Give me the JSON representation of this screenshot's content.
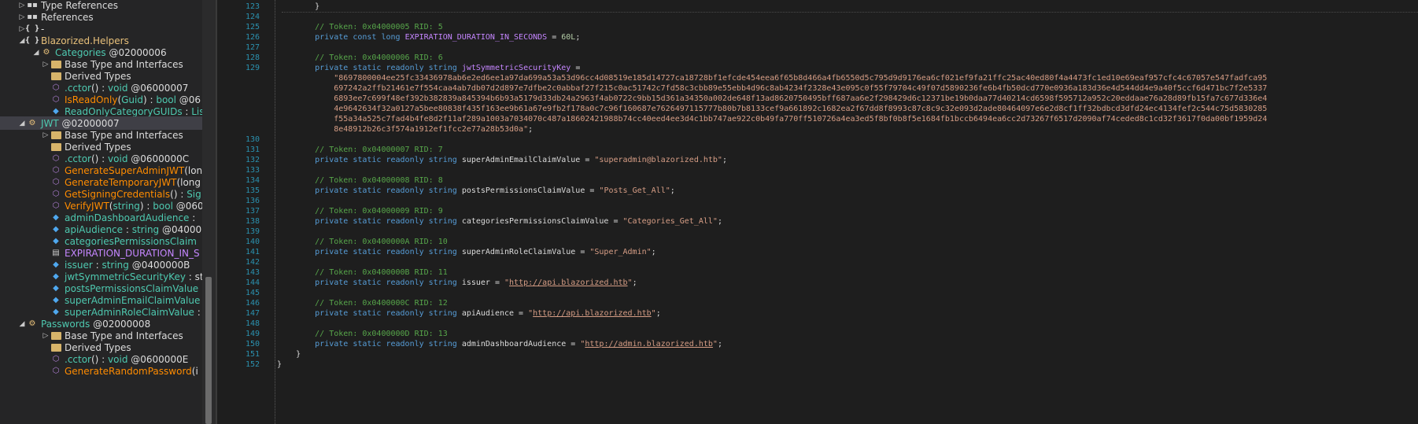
{
  "tree": {
    "items": [
      {
        "indent": 34,
        "arrow": "▷",
        "icon": "references-icon",
        "glyph": "▪▪",
        "parts": [
          {
            "c": "t-plain",
            "t": "Type References"
          }
        ]
      },
      {
        "indent": 34,
        "arrow": "▷",
        "icon": "references-icon",
        "glyph": "▪▪",
        "parts": [
          {
            "c": "t-plain",
            "t": "References"
          }
        ]
      },
      {
        "indent": 34,
        "arrow": "▷",
        "icon": "namespace-icon",
        "glyph": "{ }",
        "parts": [
          {
            "c": "t-plain",
            "t": "-"
          }
        ]
      },
      {
        "indent": 34,
        "arrow": "◢",
        "icon": "namespace-icon",
        "glyph": "{ }",
        "parts": [
          {
            "c": "t-ns",
            "t": "Blazorized.Helpers"
          }
        ]
      },
      {
        "indent": 52,
        "arrow": "◢",
        "icon": "class-icon",
        "glyph": "⚙",
        "parts": [
          {
            "c": "t-class",
            "t": "Categories"
          },
          {
            "c": "t-tok",
            "t": " @02000006"
          }
        ]
      },
      {
        "indent": 64,
        "arrow": "▷",
        "icon": "folder-icon",
        "glyph": "",
        "parts": [
          {
            "c": "t-plain",
            "t": "Base Type and Interfaces"
          }
        ]
      },
      {
        "indent": 64,
        "arrow": "",
        "icon": "folder-icon",
        "glyph": "",
        "parts": [
          {
            "c": "t-plain",
            "t": "Derived Types"
          }
        ]
      },
      {
        "indent": 64,
        "arrow": "",
        "icon": "method-icon",
        "glyph": "⬡",
        "parts": [
          {
            "c": "t-class",
            "t": ".cctor"
          },
          {
            "c": "t-plain",
            "t": "() : "
          },
          {
            "c": "t-type",
            "t": "void"
          },
          {
            "c": "t-tok",
            "t": " @06000007"
          }
        ]
      },
      {
        "indent": 64,
        "arrow": "",
        "icon": "method-icon",
        "glyph": "⬡",
        "parts": [
          {
            "c": "t-method",
            "t": "IsReadOnly"
          },
          {
            "c": "t-plain",
            "t": "("
          },
          {
            "c": "t-type",
            "t": "Guid"
          },
          {
            "c": "t-plain",
            "t": ") : "
          },
          {
            "c": "t-type",
            "t": "bool"
          },
          {
            "c": "t-tok",
            "t": " @06"
          }
        ]
      },
      {
        "indent": 64,
        "arrow": "",
        "icon": "field-icon",
        "glyph": "◆",
        "parts": [
          {
            "c": "t-class",
            "t": "ReadOnlyCategoryGUIDs"
          },
          {
            "c": "t-plain",
            "t": " : "
          },
          {
            "c": "t-type",
            "t": "Lis"
          }
        ]
      },
      {
        "indent": 34,
        "arrow": "◢",
        "icon": "class-icon",
        "glyph": "⚙",
        "sel": true,
        "parts": [
          {
            "c": "t-class",
            "t": "JWT"
          },
          {
            "c": "t-tok",
            "t": " @02000007"
          }
        ]
      },
      {
        "indent": 64,
        "arrow": "▷",
        "icon": "folder-icon",
        "glyph": "",
        "parts": [
          {
            "c": "t-plain",
            "t": "Base Type and Interfaces"
          }
        ]
      },
      {
        "indent": 64,
        "arrow": "",
        "icon": "folder-icon",
        "glyph": "",
        "parts": [
          {
            "c": "t-plain",
            "t": "Derived Types"
          }
        ]
      },
      {
        "indent": 64,
        "arrow": "",
        "icon": "method-icon",
        "glyph": "⬡",
        "parts": [
          {
            "c": "t-class",
            "t": ".cctor"
          },
          {
            "c": "t-plain",
            "t": "() : "
          },
          {
            "c": "t-type",
            "t": "void"
          },
          {
            "c": "t-tok",
            "t": " @0600000C"
          }
        ]
      },
      {
        "indent": 64,
        "arrow": "",
        "icon": "method-icon",
        "glyph": "⬡",
        "parts": [
          {
            "c": "t-method",
            "t": "GenerateSuperAdminJWT"
          },
          {
            "c": "t-plain",
            "t": "(lon"
          }
        ]
      },
      {
        "indent": 64,
        "arrow": "",
        "icon": "method-icon",
        "glyph": "⬡",
        "parts": [
          {
            "c": "t-method",
            "t": "GenerateTemporaryJWT"
          },
          {
            "c": "t-plain",
            "t": "(long"
          }
        ]
      },
      {
        "indent": 64,
        "arrow": "",
        "icon": "method-icon",
        "glyph": "⬡",
        "parts": [
          {
            "c": "t-method",
            "t": "GetSigningCredentials"
          },
          {
            "c": "t-plain",
            "t": "() : "
          },
          {
            "c": "t-type",
            "t": "Sig"
          }
        ]
      },
      {
        "indent": 64,
        "arrow": "",
        "icon": "method-icon",
        "glyph": "⬡",
        "parts": [
          {
            "c": "t-method",
            "t": "VerifyJWT"
          },
          {
            "c": "t-plain",
            "t": "("
          },
          {
            "c": "t-type",
            "t": "string"
          },
          {
            "c": "t-plain",
            "t": ") : "
          },
          {
            "c": "t-type",
            "t": "bool"
          },
          {
            "c": "t-tok",
            "t": " @060"
          }
        ]
      },
      {
        "indent": 64,
        "arrow": "",
        "icon": "field-icon",
        "glyph": "◆",
        "parts": [
          {
            "c": "t-class",
            "t": "adminDashboardAudience"
          },
          {
            "c": "t-plain",
            "t": " :"
          }
        ]
      },
      {
        "indent": 64,
        "arrow": "",
        "icon": "field-icon",
        "glyph": "◆",
        "parts": [
          {
            "c": "t-class",
            "t": "apiAudience"
          },
          {
            "c": "t-plain",
            "t": " : "
          },
          {
            "c": "t-type",
            "t": "string"
          },
          {
            "c": "t-tok",
            "t": " @04000"
          }
        ]
      },
      {
        "indent": 64,
        "arrow": "",
        "icon": "field-icon",
        "glyph": "◆",
        "parts": [
          {
            "c": "t-class",
            "t": "categoriesPermissionsClaim"
          }
        ]
      },
      {
        "indent": 64,
        "arrow": "",
        "icon": "const-icon",
        "glyph": "▤",
        "parts": [
          {
            "c": "t-const",
            "t": "EXPIRATION_DURATION_IN_S"
          }
        ]
      },
      {
        "indent": 64,
        "arrow": "",
        "icon": "field-icon",
        "glyph": "◆",
        "parts": [
          {
            "c": "t-class",
            "t": "issuer"
          },
          {
            "c": "t-plain",
            "t": " : "
          },
          {
            "c": "t-type",
            "t": "string"
          },
          {
            "c": "t-tok",
            "t": " @0400000B"
          }
        ]
      },
      {
        "indent": 64,
        "arrow": "",
        "icon": "field-icon",
        "glyph": "◆",
        "parts": [
          {
            "c": "t-class",
            "t": "jwtSymmetricSecurityKey"
          },
          {
            "c": "t-plain",
            "t": " : st"
          }
        ]
      },
      {
        "indent": 64,
        "arrow": "",
        "icon": "field-icon",
        "glyph": "◆",
        "parts": [
          {
            "c": "t-class",
            "t": "postsPermissionsClaimValue"
          }
        ]
      },
      {
        "indent": 64,
        "arrow": "",
        "icon": "field-icon",
        "glyph": "◆",
        "parts": [
          {
            "c": "t-class",
            "t": "superAdminEmailClaimValue"
          }
        ]
      },
      {
        "indent": 64,
        "arrow": "",
        "icon": "field-icon",
        "glyph": "◆",
        "parts": [
          {
            "c": "t-class",
            "t": "superAdminRoleClaimValue"
          },
          {
            "c": "t-plain",
            "t": " :"
          }
        ]
      },
      {
        "indent": 34,
        "arrow": "◢",
        "icon": "class-icon",
        "glyph": "⚙",
        "parts": [
          {
            "c": "t-class",
            "t": "Passwords"
          },
          {
            "c": "t-tok",
            "t": " @02000008"
          }
        ]
      },
      {
        "indent": 64,
        "arrow": "▷",
        "icon": "folder-icon",
        "glyph": "",
        "parts": [
          {
            "c": "t-plain",
            "t": "Base Type and Interfaces"
          }
        ]
      },
      {
        "indent": 64,
        "arrow": "",
        "icon": "folder-icon",
        "glyph": "",
        "parts": [
          {
            "c": "t-plain",
            "t": "Derived Types"
          }
        ]
      },
      {
        "indent": 64,
        "arrow": "",
        "icon": "method-icon",
        "glyph": "⬡",
        "parts": [
          {
            "c": "t-class",
            "t": ".cctor"
          },
          {
            "c": "t-plain",
            "t": "() : "
          },
          {
            "c": "t-type",
            "t": "void"
          },
          {
            "c": "t-tok",
            "t": " @0600000E"
          }
        ]
      },
      {
        "indent": 64,
        "arrow": "",
        "icon": "method-icon",
        "glyph": "⬡",
        "parts": [
          {
            "c": "t-method",
            "t": "GenerateRandomPassword"
          },
          {
            "c": "t-plain",
            "t": "(i"
          }
        ]
      }
    ]
  },
  "editor": {
    "lines": [
      {
        "n": "123",
        "parts": [
          {
            "c": "",
            "t": "        }"
          }
        ]
      },
      {
        "n": "124",
        "parts": []
      },
      {
        "n": "125",
        "parts": [
          {
            "c": "c-comment",
            "t": "        // Token: 0x04000005 RID: 5"
          }
        ]
      },
      {
        "n": "126",
        "parts": [
          {
            "c": "c-kw",
            "t": "        private const long "
          },
          {
            "c": "c-field",
            "t": "EXPIRATION_DURATION_IN_SECONDS"
          },
          {
            "c": "",
            "t": " = "
          },
          {
            "c": "c-num",
            "t": "60L"
          },
          {
            "c": "",
            "t": ";"
          }
        ]
      },
      {
        "n": "127",
        "parts": []
      },
      {
        "n": "128",
        "parts": [
          {
            "c": "c-comment",
            "t": "        // Token: 0x04000006 RID: 6"
          }
        ]
      },
      {
        "n": "129",
        "parts": [
          {
            "c": "c-kw",
            "t": "        private static readonly string "
          },
          {
            "c": "c-field",
            "t": "jwtSymmetricSecurityKey"
          },
          {
            "c": "",
            "t": " ="
          }
        ]
      },
      {
        "n": "",
        "parts": [
          {
            "c": "c-str",
            "t": "            \"8697800004ee25fc33436978ab6e2ed6ee1a97da699a53a53d96cc4d08519e185d14727ca18728bf1efcde454eea6f65b8d466a4fb6550d5c795d9d9176ea6cf021ef9fa21ffc25ac40ed80f4a4473fc1ed10e69eaf957cfc4c67057e547fadfca95"
          }
        ]
      },
      {
        "n": "",
        "parts": [
          {
            "c": "c-str",
            "t": "            697242a2ffb21461e7f554caa4ab7db07d2d897e7dfbe2c0abbaf27f215c0ac51742c7fd58c3cbb89e55ebb4d96c8ab4234f2328e43e095c0f55f79704c49f07d5890236fe6b4fb50dcd770e0936a183d36e4d544dd4e9a40f5ccf6d471bc7f2e5337"
          }
        ]
      },
      {
        "n": "",
        "parts": [
          {
            "c": "c-str",
            "t": "            6893ee7c699f48ef392b382839a845394b6b93a5179d33db24a2963f4ab0722c9bb15d361a34350a002de648f13ad8620750495bff687aa6e2f298429d6c12371be19b0daa77d40214cd6598f595712a952c20eddaae76a28d89fb15fa7c677d336e4"
          }
        ]
      },
      {
        "n": "",
        "parts": [
          {
            "c": "c-str",
            "t": "            4e9642634f32a0127a5bee80838f435f163ee9b61a67e9fb2f178a0c7c96f160687e7626497115777b80b7b8133cef9a661892c1682ea2f67dd8f8993c87c8c9c32e093d2ade80464097e6e2d8cf1ff32bdbcd3dfd24ec4134fef2c544c75d5830285"
          }
        ]
      },
      {
        "n": "",
        "parts": [
          {
            "c": "c-str",
            "t": "            f55a34a525c7fad4b4fe8d2f11af289a1003a7034070c487a18602421988b74cc40eed4ee3d4c1bb747ae922c0b49fa770ff510726a4ea3ed5f8bf0b8f5e1684fb1bccb6494ea6cc2d73267f6517d2090af74ceded8c1cd32f3617f0da00bf1959d24"
          }
        ]
      },
      {
        "n": "",
        "parts": [
          {
            "c": "c-str",
            "t": "            8e48912b26c3f574a1912ef1fcc2e77a28b53d0a\""
          },
          {
            "c": "",
            "t": ";"
          }
        ]
      },
      {
        "n": "130",
        "parts": []
      },
      {
        "n": "131",
        "parts": [
          {
            "c": "c-comment",
            "t": "        // Token: 0x04000007 RID: 7"
          }
        ]
      },
      {
        "n": "132",
        "parts": [
          {
            "c": "c-kw",
            "t": "        private static readonly string "
          },
          {
            "c": "",
            "t": "superAdminEmailClaimValue = "
          },
          {
            "c": "c-str",
            "t": "\"superadmin@blazorized.htb\""
          },
          {
            "c": "",
            "t": ";"
          }
        ]
      },
      {
        "n": "133",
        "parts": []
      },
      {
        "n": "134",
        "parts": [
          {
            "c": "c-comment",
            "t": "        // Token: 0x04000008 RID: 8"
          }
        ]
      },
      {
        "n": "135",
        "parts": [
          {
            "c": "c-kw",
            "t": "        private static readonly string "
          },
          {
            "c": "",
            "t": "postsPermissionsClaimValue = "
          },
          {
            "c": "c-str",
            "t": "\"Posts_Get_All\""
          },
          {
            "c": "",
            "t": ";"
          }
        ]
      },
      {
        "n": "136",
        "parts": []
      },
      {
        "n": "137",
        "parts": [
          {
            "c": "c-comment",
            "t": "        // Token: 0x04000009 RID: 9"
          }
        ]
      },
      {
        "n": "138",
        "parts": [
          {
            "c": "c-kw",
            "t": "        private static readonly string "
          },
          {
            "c": "",
            "t": "categoriesPermissionsClaimValue = "
          },
          {
            "c": "c-str",
            "t": "\"Categories_Get_All\""
          },
          {
            "c": "",
            "t": ";"
          }
        ]
      },
      {
        "n": "139",
        "parts": []
      },
      {
        "n": "140",
        "parts": [
          {
            "c": "c-comment",
            "t": "        // Token: 0x0400000A RID: 10"
          }
        ]
      },
      {
        "n": "141",
        "parts": [
          {
            "c": "c-kw",
            "t": "        private static readonly string "
          },
          {
            "c": "",
            "t": "superAdminRoleClaimValue = "
          },
          {
            "c": "c-str",
            "t": "\"Super_Admin\""
          },
          {
            "c": "",
            "t": ";"
          }
        ]
      },
      {
        "n": "142",
        "parts": []
      },
      {
        "n": "143",
        "parts": [
          {
            "c": "c-comment",
            "t": "        // Token: 0x0400000B RID: 11"
          }
        ]
      },
      {
        "n": "144",
        "parts": [
          {
            "c": "c-kw",
            "t": "        private static readonly string "
          },
          {
            "c": "",
            "t": "issuer = "
          },
          {
            "c": "c-str",
            "t": "\""
          },
          {
            "c": "c-link",
            "t": "http://api.blazorized.htb"
          },
          {
            "c": "c-str",
            "t": "\""
          },
          {
            "c": "",
            "t": ";"
          }
        ]
      },
      {
        "n": "145",
        "parts": []
      },
      {
        "n": "146",
        "parts": [
          {
            "c": "c-comment",
            "t": "        // Token: 0x0400000C RID: 12"
          }
        ]
      },
      {
        "n": "147",
        "parts": [
          {
            "c": "c-kw",
            "t": "        private static readonly string "
          },
          {
            "c": "",
            "t": "apiAudience = "
          },
          {
            "c": "c-str",
            "t": "\""
          },
          {
            "c": "c-link",
            "t": "http://api.blazorized.htb"
          },
          {
            "c": "c-str",
            "t": "\""
          },
          {
            "c": "",
            "t": ";"
          }
        ]
      },
      {
        "n": "148",
        "parts": []
      },
      {
        "n": "149",
        "parts": [
          {
            "c": "c-comment",
            "t": "        // Token: 0x0400000D RID: 13"
          }
        ]
      },
      {
        "n": "150",
        "parts": [
          {
            "c": "c-kw",
            "t": "        private static readonly string "
          },
          {
            "c": "",
            "t": "adminDashboardAudience = "
          },
          {
            "c": "c-str",
            "t": "\""
          },
          {
            "c": "c-link",
            "t": "http://admin.blazorized.htb"
          },
          {
            "c": "c-str",
            "t": "\""
          },
          {
            "c": "",
            "t": ";"
          }
        ]
      },
      {
        "n": "151",
        "parts": [
          {
            "c": "",
            "t": "    }"
          }
        ]
      },
      {
        "n": "152",
        "parts": [
          {
            "c": "",
            "t": "}"
          }
        ]
      }
    ]
  }
}
